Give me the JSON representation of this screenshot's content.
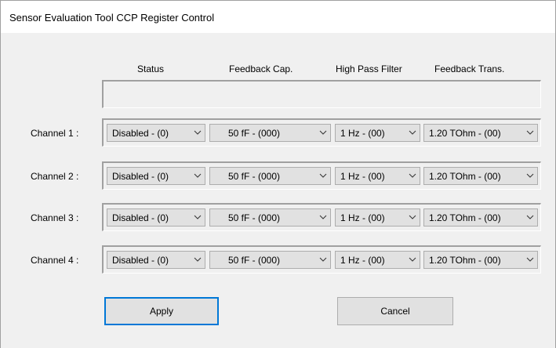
{
  "window": {
    "title": "Sensor Evaluation Tool CCP Register Control"
  },
  "headers": {
    "status": "Status",
    "feedback_cap": "Feedback Cap.",
    "high_pass_filter": "High Pass Filter",
    "feedback_trans": "Feedback Trans."
  },
  "channels": [
    {
      "label": "Channel 1 :",
      "status": "Disabled - (0)",
      "feedback_cap": "50 fF  - (000)",
      "high_pass_filter": "1 Hz  - (00)",
      "feedback_trans": "1.20 TOhm  - (00)"
    },
    {
      "label": "Channel 2 :",
      "status": "Disabled - (0)",
      "feedback_cap": "50 fF  - (000)",
      "high_pass_filter": "1 Hz  - (00)",
      "feedback_trans": "1.20 TOhm  - (00)"
    },
    {
      "label": "Channel 3 :",
      "status": "Disabled - (0)",
      "feedback_cap": "50 fF  - (000)",
      "high_pass_filter": "1 Hz  - (00)",
      "feedback_trans": "1.20 TOhm  - (00)"
    },
    {
      "label": "Channel 4 :",
      "status": "Disabled - (0)",
      "feedback_cap": "50 fF  - (000)",
      "high_pass_filter": "1 Hz  - (00)",
      "feedback_trans": "1.20 TOhm  - (00)"
    }
  ],
  "buttons": {
    "apply": "Apply",
    "cancel": "Cancel"
  },
  "colors": {
    "accent": "#0078d7",
    "background": "#f0f0f0",
    "control": "#e1e1e1"
  }
}
